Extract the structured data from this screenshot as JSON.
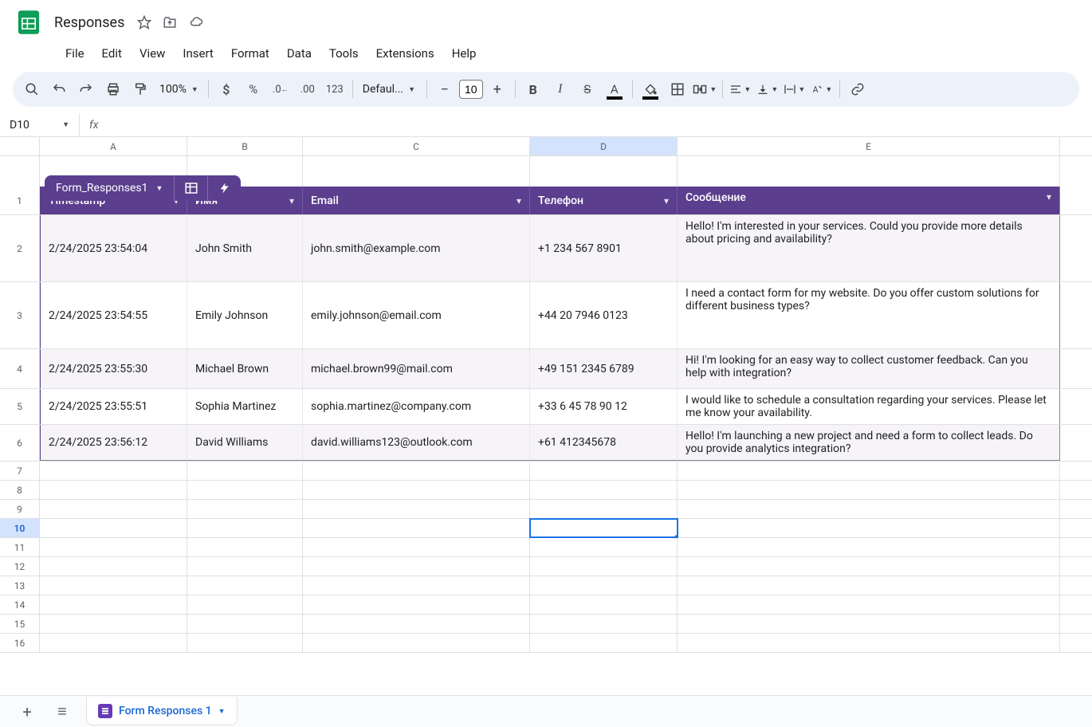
{
  "doc": {
    "title": "Responses"
  },
  "menus": [
    "File",
    "Edit",
    "View",
    "Insert",
    "Format",
    "Data",
    "Tools",
    "Extensions",
    "Help"
  ],
  "toolbar": {
    "zoom": "100%",
    "font": "Defaul...",
    "font_size": "10"
  },
  "name_box": "D10",
  "formula": "",
  "columns": [
    "A",
    "B",
    "C",
    "D",
    "E"
  ],
  "selected_col_index": 3,
  "selected_row_index": 10,
  "table_tab": "Form_Responses1",
  "headers": [
    "Timestamp",
    "Имя",
    "Email",
    "Телефон",
    "Сообщение"
  ],
  "rows": [
    {
      "ts": "2/24/2025 23:54:04",
      "name": "John Smith",
      "email": "john.smith@example.com",
      "phone": "+1 234 567 8901",
      "msg": "Hello! I'm interested in your services. Could you provide more details about pricing and availability?"
    },
    {
      "ts": "2/24/2025 23:54:55",
      "name": "Emily Johnson",
      "email": "emily.johnson@email.com",
      "phone": "+44 20 7946 0123",
      "msg": " I need a contact form for my website. Do you offer custom solutions for different business types?"
    },
    {
      "ts": "2/24/2025 23:55:30",
      "name": "Michael Brown",
      "email": "michael.brown99@mail.com",
      "phone": "+49 151 2345 6789",
      "msg": "Hi! I'm looking for an easy way to collect customer feedback. Can you help with integration?"
    },
    {
      "ts": "2/24/2025 23:55:51",
      "name": "Sophia Martinez",
      "email": "sophia.martinez@company.com",
      "phone": "+33 6 45 78 90 12",
      "msg": "I would like to schedule a consultation regarding your services. Please let me know your availability."
    },
    {
      "ts": "2/24/2025 23:56:12",
      "name": "David Williams",
      "email": "david.williams123@outlook.com",
      "phone": "+61 412345678",
      "msg": "Hello! I'm launching a new project and need a form to collect leads. Do you provide analytics integration?"
    }
  ],
  "empty_rows": [
    7,
    8,
    9,
    10,
    11,
    12,
    13,
    14,
    15,
    16
  ],
  "sheet_tab": "Form Responses 1"
}
